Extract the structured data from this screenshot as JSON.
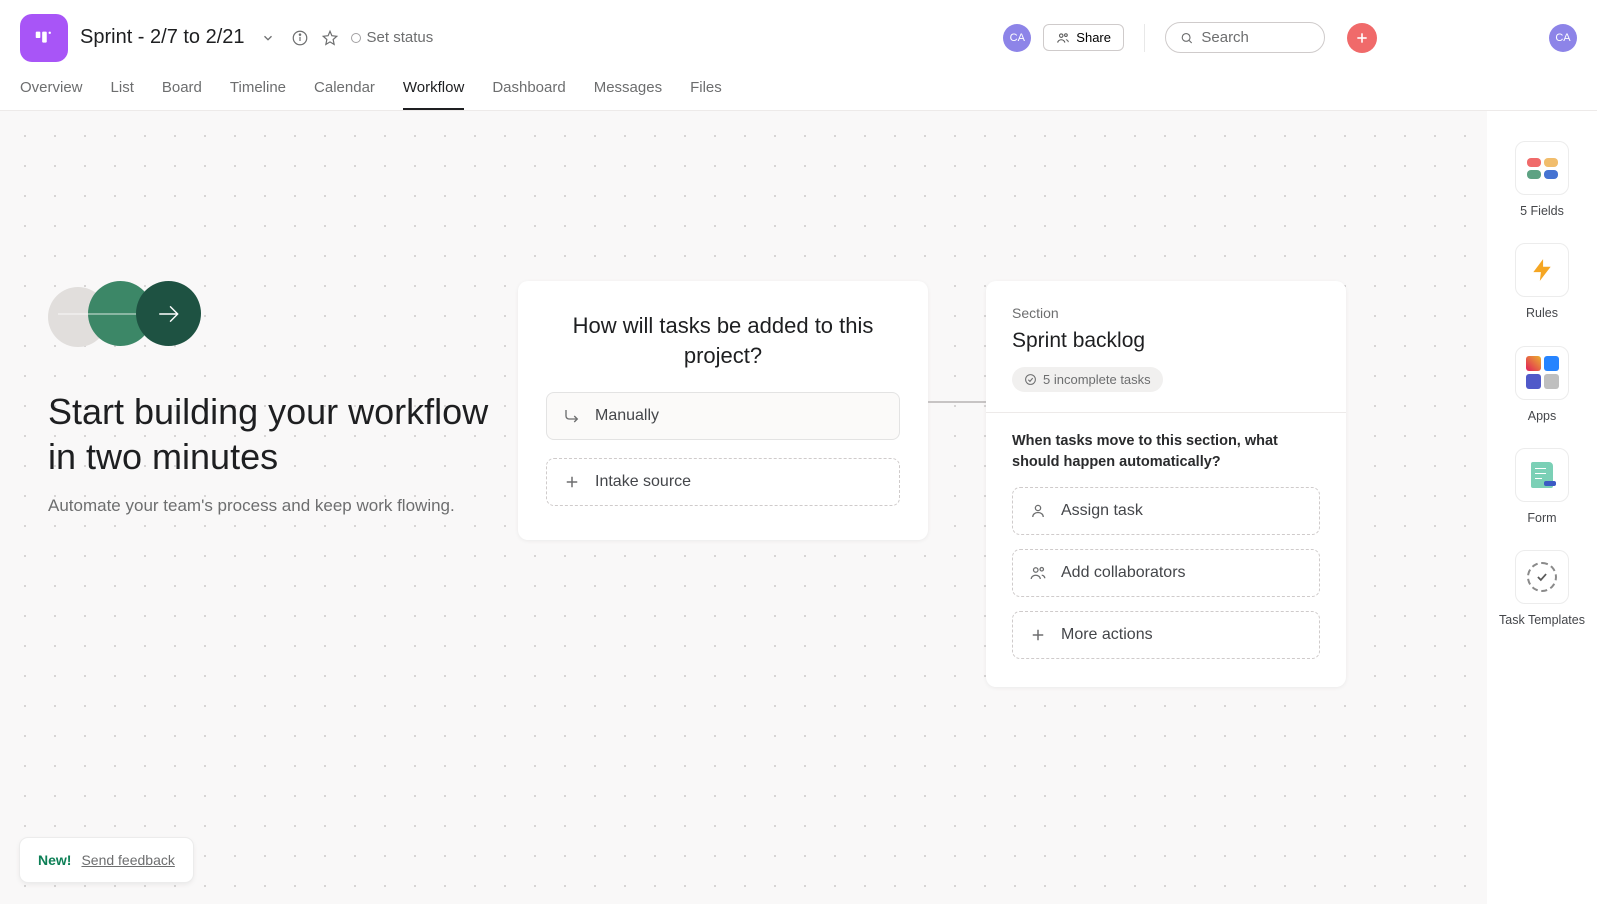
{
  "header": {
    "project_title": "Sprint - 2/7 to 2/21",
    "set_status": "Set status",
    "share": "Share",
    "search_placeholder": "Search",
    "avatar_initials": "CA"
  },
  "tabs": [
    {
      "label": "Overview",
      "active": false
    },
    {
      "label": "List",
      "active": false
    },
    {
      "label": "Board",
      "active": false
    },
    {
      "label": "Timeline",
      "active": false
    },
    {
      "label": "Calendar",
      "active": false
    },
    {
      "label": "Workflow",
      "active": true
    },
    {
      "label": "Dashboard",
      "active": false
    },
    {
      "label": "Messages",
      "active": false
    },
    {
      "label": "Files",
      "active": false
    }
  ],
  "hero": {
    "title": "Start building your workflow in two minutes",
    "subtitle": "Automate your team's process and keep work flowing."
  },
  "add_card": {
    "heading": "How will tasks be added to this project?",
    "manually": "Manually",
    "intake": "Intake source"
  },
  "section_card": {
    "label": "Section",
    "title": "Sprint backlog",
    "badge": "5 incomplete tasks",
    "question": "When tasks move to this section, what should happen automatically?",
    "actions": {
      "assign": "Assign task",
      "collab": "Add collaborators",
      "more": "More actions"
    }
  },
  "rail": {
    "fields": "5 Fields",
    "rules": "Rules",
    "apps": "Apps",
    "form": "Form",
    "templates": "Task Templates"
  },
  "feedback": {
    "new": "New!",
    "link": "Send feedback"
  },
  "colors": {
    "accent": "#a855f7",
    "plus": "#f06a6a",
    "avatar": "#8d84e8"
  }
}
